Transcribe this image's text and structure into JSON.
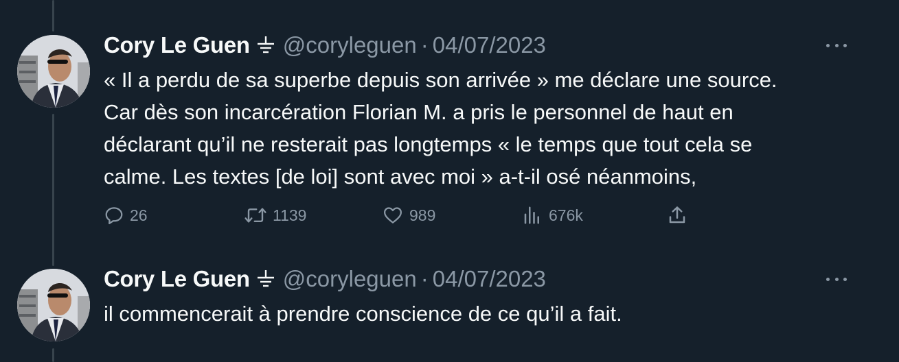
{
  "theme": {
    "background": "#15202b",
    "text_primary": "#f7f9f9",
    "text_secondary": "#8b98a5",
    "thread_line": "#38444d"
  },
  "tweets": [
    {
      "author": {
        "name": "Cory Le Guen",
        "badge_icon": "ground-symbol-icon",
        "handle": "@coryleguen"
      },
      "separator": "·",
      "date": "04/07/2023",
      "text_lines": [
        "« Il a perdu de sa superbe depuis son arrivée » me déclare une source.",
        "Car dès son incarcération Florian M. a pris le personnel de haut en",
        "déclarant qu’il ne resterait pas longtemps « le temps que tout cela se",
        "calme. Les textes [de loi] sont avec moi » a-t-il osé néanmoins,"
      ],
      "actions": {
        "replies": "26",
        "retweets": "1139",
        "likes": "989",
        "views": "676k"
      }
    },
    {
      "author": {
        "name": "Cory Le Guen",
        "badge_icon": "ground-symbol-icon",
        "handle": "@coryleguen"
      },
      "separator": "·",
      "date": "04/07/2023",
      "text_lines": [
        "il commencerait à prendre conscience de ce qu’il a fait."
      ]
    }
  ]
}
